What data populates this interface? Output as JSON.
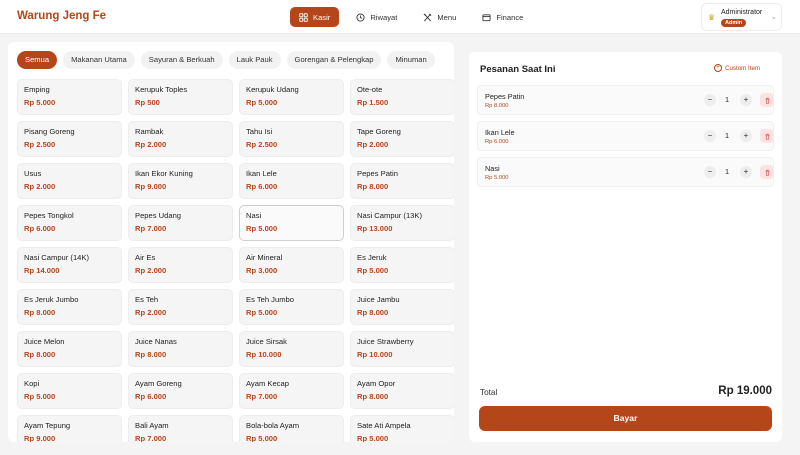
{
  "header": {
    "brand": "Warung Jeng Fe",
    "nav": [
      {
        "label": "Kasir",
        "icon": "grid-icon",
        "active": true
      },
      {
        "label": "Riwayat",
        "icon": "history-icon",
        "active": false
      },
      {
        "label": "Menu",
        "icon": "utensils-icon",
        "active": false
      },
      {
        "label": "Finance",
        "icon": "wallet-icon",
        "active": false
      }
    ],
    "user": {
      "name": "Administrator",
      "role": "Admin",
      "icon": "crown-icon"
    }
  },
  "categories": [
    {
      "label": "Semua",
      "active": true
    },
    {
      "label": "Makanan Utama",
      "active": false
    },
    {
      "label": "Sayuran & Berkuah",
      "active": false
    },
    {
      "label": "Lauk Pauk",
      "active": false
    },
    {
      "label": "Gorengan & Pelengkap",
      "active": false
    },
    {
      "label": "Minuman",
      "active": false
    }
  ],
  "products": [
    {
      "name": "Emping",
      "price": "Rp 5.000"
    },
    {
      "name": "Kerupuk Toples",
      "price": "Rp 500"
    },
    {
      "name": "Kerupuk Udang",
      "price": "Rp 5.000"
    },
    {
      "name": "Ote-ote",
      "price": "Rp 1.500"
    },
    {
      "name": "Pisang Goreng",
      "price": "Rp 2.500"
    },
    {
      "name": "Rambak",
      "price": "Rp 2.000"
    },
    {
      "name": "Tahu Isi",
      "price": "Rp 2.500"
    },
    {
      "name": "Tape Goreng",
      "price": "Rp 2.000"
    },
    {
      "name": "Usus",
      "price": "Rp 2.000"
    },
    {
      "name": "Ikan Ekor Kuning",
      "price": "Rp 9.000"
    },
    {
      "name": "Ikan Lele",
      "price": "Rp 6.000"
    },
    {
      "name": "Pepes Patin",
      "price": "Rp 8.000"
    },
    {
      "name": "Pepes Tongkol",
      "price": "Rp 6.000"
    },
    {
      "name": "Pepes Udang",
      "price": "Rp 7.000"
    },
    {
      "name": "Nasi",
      "price": "Rp 5.000",
      "selected": true
    },
    {
      "name": "Nasi Campur (13K)",
      "price": "Rp 13.000"
    },
    {
      "name": "Nasi Campur (14K)",
      "price": "Rp 14.000"
    },
    {
      "name": "Air Es",
      "price": "Rp 2.000"
    },
    {
      "name": "Air Mineral",
      "price": "Rp 3.000"
    },
    {
      "name": "Es Jeruk",
      "price": "Rp 5.000"
    },
    {
      "name": "Es Jeruk Jumbo",
      "price": "Rp 8.000"
    },
    {
      "name": "Es Teh",
      "price": "Rp 2.000"
    },
    {
      "name": "Es Teh Jumbo",
      "price": "Rp 5.000"
    },
    {
      "name": "Juice Jambu",
      "price": "Rp 8.000"
    },
    {
      "name": "Juice Melon",
      "price": "Rp 8.000"
    },
    {
      "name": "Juice Nanas",
      "price": "Rp 8.000"
    },
    {
      "name": "Juice Sirsak",
      "price": "Rp 10.000"
    },
    {
      "name": "Juice Strawberry",
      "price": "Rp 10.000"
    },
    {
      "name": "Kopi",
      "price": "Rp 5.000"
    },
    {
      "name": "Ayam Goreng",
      "price": "Rp 6.000"
    },
    {
      "name": "Ayam Kecap",
      "price": "Rp 7.000"
    },
    {
      "name": "Ayam Opor",
      "price": "Rp 8.000"
    },
    {
      "name": "Ayam Tepung",
      "price": "Rp 9.000"
    },
    {
      "name": "Bali Ayam",
      "price": "Rp 7.000"
    },
    {
      "name": "Bola-bola Ayam",
      "price": "Rp 5.000"
    },
    {
      "name": "Sate Ati Ampela",
      "price": "Rp 5.000"
    }
  ],
  "order": {
    "title": "Pesanan Saat Ini",
    "custom_label": "Custom Item",
    "items": [
      {
        "name": "Pepes Patin",
        "price": "Rp 8.000",
        "qty": "1"
      },
      {
        "name": "Ikan Lele",
        "price": "Rp 6.000",
        "qty": "1"
      },
      {
        "name": "Nasi",
        "price": "Rp 5.000",
        "qty": "1"
      }
    ],
    "minus": "−",
    "plus": "+",
    "total_label": "Total",
    "total_value": "Rp 19.000",
    "pay_label": "Bayar"
  },
  "colors": {
    "accent": "#b5461a",
    "danger_bg": "#fde3e3",
    "danger": "#e05555"
  }
}
